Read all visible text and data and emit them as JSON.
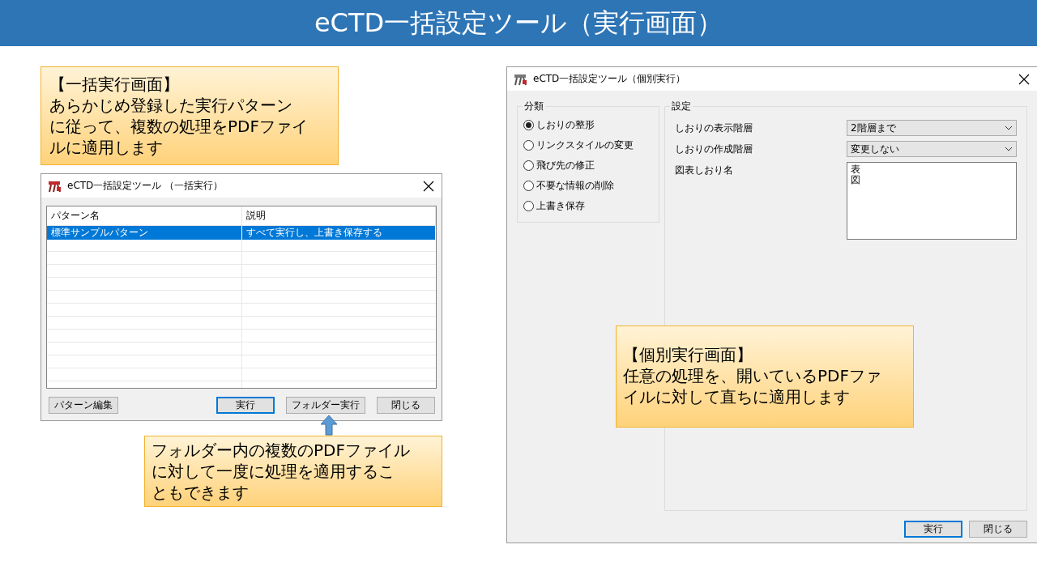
{
  "title": "eCTD一括設定ツール（実行画面）",
  "batch_callout": {
    "heading": "【一括実行画面】",
    "lines": [
      "あらかじめ登録した実行パターン",
      "に従って、複数の処理をPDFファイ",
      "ルに適用します"
    ]
  },
  "batch_window": {
    "title": "eCTD一括設定ツール （一括実行）",
    "columns": [
      "パターン名",
      "説明"
    ],
    "rows": [
      {
        "cells": [
          "標準サンプルパターン",
          "すべて実行し、上書き保存する"
        ],
        "selected": true
      }
    ],
    "buttons": [
      {
        "label": "パターン編集",
        "default": false
      },
      {
        "label": "実行",
        "default": true
      },
      {
        "label": "フォルダー実行",
        "default": false
      },
      {
        "label": "閉じる",
        "default": false
      }
    ]
  },
  "folder_callout": {
    "lines": [
      "フォルダー内の複数のPDFファイル",
      "に対して一度に処理を適用するこ",
      "ともできます"
    ]
  },
  "single_window": {
    "title": "eCTD一括設定ツール（個別実行）",
    "category_group": {
      "label": "分類",
      "options": [
        {
          "label": "しおりの整形",
          "selected": true
        },
        {
          "label": "リンクスタイルの変更",
          "selected": false
        },
        {
          "label": "飛び先の修正",
          "selected": false
        },
        {
          "label": "不要な情報の削除",
          "selected": false
        },
        {
          "label": "上書き保存",
          "selected": false
        }
      ]
    },
    "settings_group": {
      "label": "設定",
      "fields": [
        {
          "kind": "dropdown",
          "label": "しおりの表示階層",
          "value": "2階層まで"
        },
        {
          "kind": "dropdown",
          "label": "しおりの作成階層",
          "value": "変更しない"
        },
        {
          "kind": "textarea",
          "label": "図表しおり名",
          "lines": [
            "表",
            "図"
          ]
        }
      ]
    },
    "buttons": [
      {
        "label": "実行",
        "default": true
      },
      {
        "label": "閉じる",
        "default": false
      }
    ]
  },
  "single_callout": {
    "heading": "【個別実行画面】",
    "lines": [
      "任意の処理を、開いているPDFファ",
      "イルに対して直ちに適用します"
    ]
  }
}
